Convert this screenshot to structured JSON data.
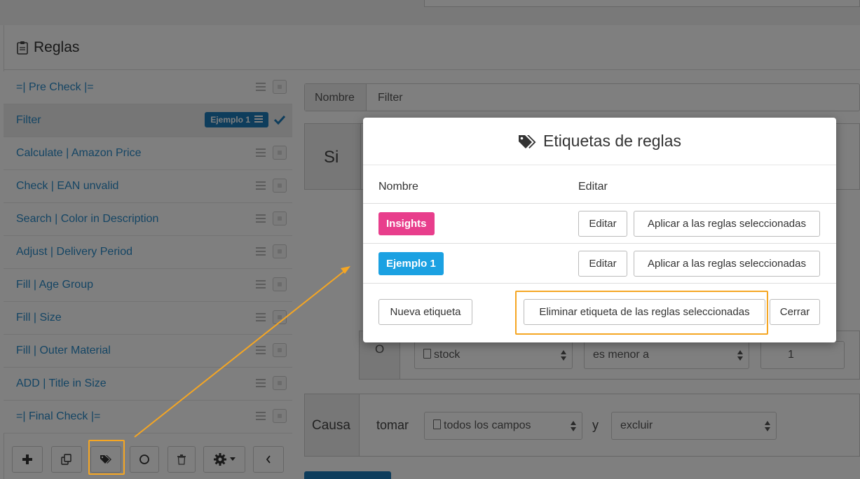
{
  "header": {
    "title": "Reglas"
  },
  "rules": [
    {
      "label": "=| Pre Check |=",
      "checked": false
    },
    {
      "label": "Filter",
      "checked": true,
      "active": true,
      "tag": "Ejemplo 1"
    },
    {
      "label": "Calculate | Amazon Price",
      "checked": false
    },
    {
      "label": "Check | EAN unvalid",
      "checked": false
    },
    {
      "label": "Search | Color in Description",
      "checked": false
    },
    {
      "label": "Adjust | Delivery Period",
      "checked": false
    },
    {
      "label": "Fill | Age Group",
      "checked": false
    },
    {
      "label": "Fill | Size",
      "checked": false
    },
    {
      "label": "Fill | Outer Material",
      "checked": false
    },
    {
      "label": "ADD | Title in Size",
      "checked": false
    },
    {
      "label": "=| Final Check |=",
      "checked": false
    }
  ],
  "toolbar": {
    "icons": [
      "plus-icon",
      "copy-icon",
      "tags-icon",
      "circle-icon",
      "trash-icon",
      "gear-icon",
      "chevron-left-icon"
    ]
  },
  "editor": {
    "name_label": "Nombre",
    "name_value": "Filter",
    "if_label": "Si",
    "or_label": "O",
    "condition": {
      "field": "stock",
      "operator": "es menor a",
      "value": "1"
    },
    "cause_label": "Causa",
    "take_label": "tomar",
    "cause_field": "todos los campos",
    "and_label": "y",
    "cause_action": "excluir"
  },
  "modal": {
    "title": "Etiquetas de reglas",
    "col_name": "Nombre",
    "col_edit": "Editar",
    "tags": [
      {
        "name": "Insights",
        "color": "#e83e8c",
        "edit_label": "Editar",
        "apply_label": "Aplicar a las reglas seleccionadas"
      },
      {
        "name": "Ejemplo 1",
        "color": "#1ba1e2",
        "edit_label": "Editar",
        "apply_label": "Aplicar a las reglas seleccionadas"
      }
    ],
    "new_tag_label": "Nueva etiqueta",
    "remove_label": "Eliminar etiqueta de las reglas seleccionadas",
    "close_label": "Cerrar"
  },
  "colors": {
    "link": "#2a8bc9",
    "highlight": "#f5a623",
    "tag_blue": "#1d7bb8"
  }
}
